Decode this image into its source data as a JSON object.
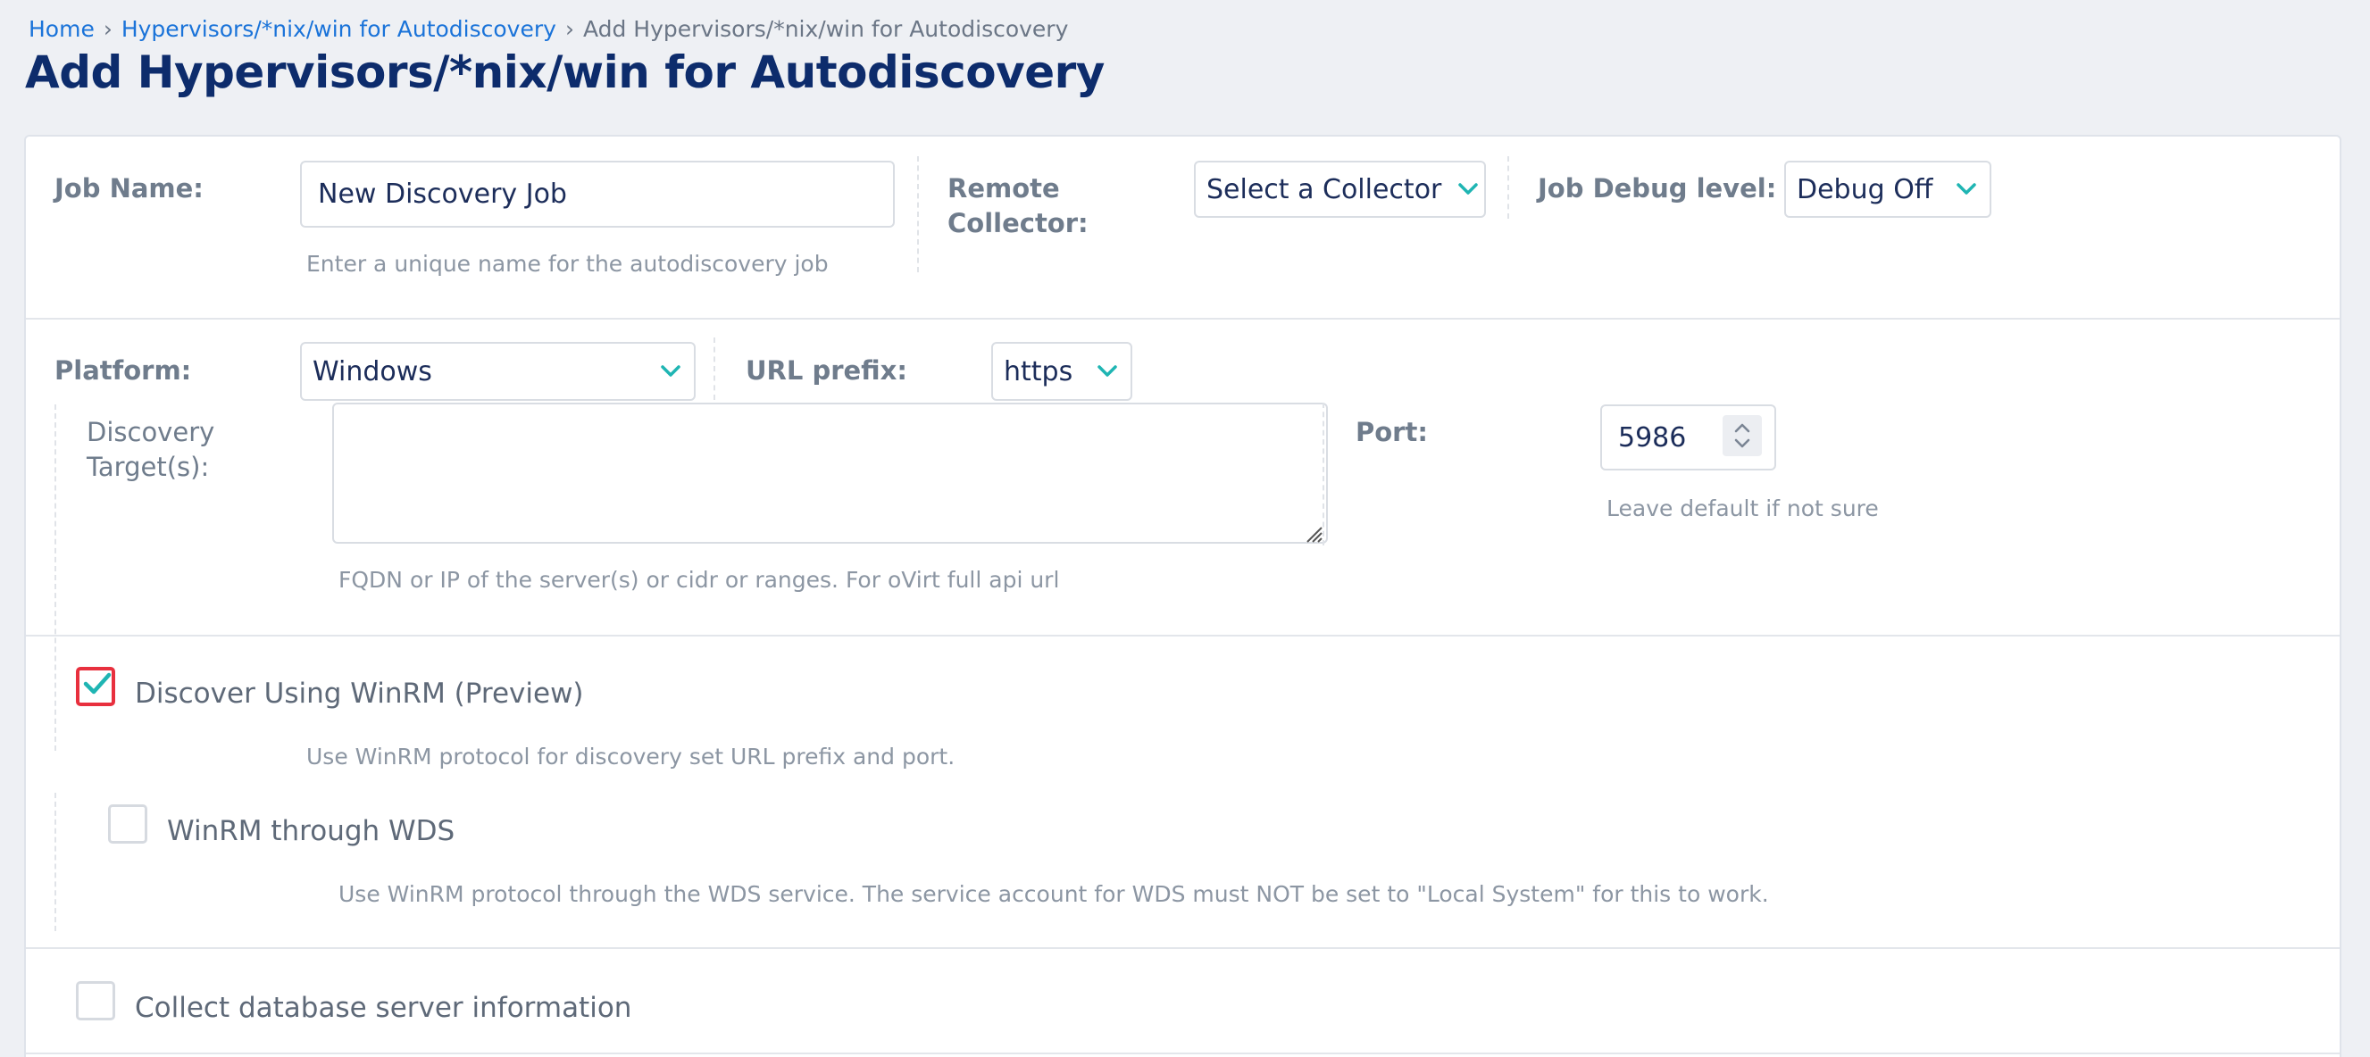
{
  "breadcrumb": {
    "home": "Home",
    "parent": "Hypervisors/*nix/win for Autodiscovery",
    "current": "Add Hypervisors/*nix/win for Autodiscovery"
  },
  "page_title": "Add Hypervisors/*nix/win for Autodiscovery",
  "job": {
    "name_label": "Job Name:",
    "name_value": "New Discovery Job",
    "name_help": "Enter a unique name for the autodiscovery job",
    "collector_label_line1": "Remote",
    "collector_label_line2": "Collector:",
    "collector_value": "Select a Collector",
    "debug_label": "Job Debug level:",
    "debug_value": "Debug Off"
  },
  "platform": {
    "label": "Platform:",
    "value": "Windows",
    "url_prefix_label": "URL prefix:",
    "url_prefix_value": "https",
    "targets_label_line1": "Discovery",
    "targets_label_line2": "Target(s):",
    "targets_value": "",
    "targets_help": "FQDN or IP of the server(s) or cidr or ranges. For oVirt full api url",
    "port_label": "Port:",
    "port_value": "5986",
    "port_help": "Leave default if not sure"
  },
  "winrm": {
    "label": "Discover Using WinRM (Preview)",
    "checked": true,
    "help": "Use WinRM protocol for discovery set URL prefix and port.",
    "wds_label": "WinRM through WDS",
    "wds_checked": false,
    "wds_help": "Use WinRM protocol through the WDS service. The service account for WDS must NOT be set to \"Local System\" for this to work."
  },
  "database": {
    "label": "Collect database server information",
    "checked": false
  },
  "colors": {
    "accent": "#1fb5b3",
    "link": "#1a73d9",
    "title": "#0d2c6c",
    "focus_border": "#e8303e"
  },
  "icons": {
    "dropdown": "chevron-down-icon",
    "check": "checkmark-icon",
    "spinner": "up-down-arrows-icon",
    "resize": "resize-grip-icon"
  }
}
